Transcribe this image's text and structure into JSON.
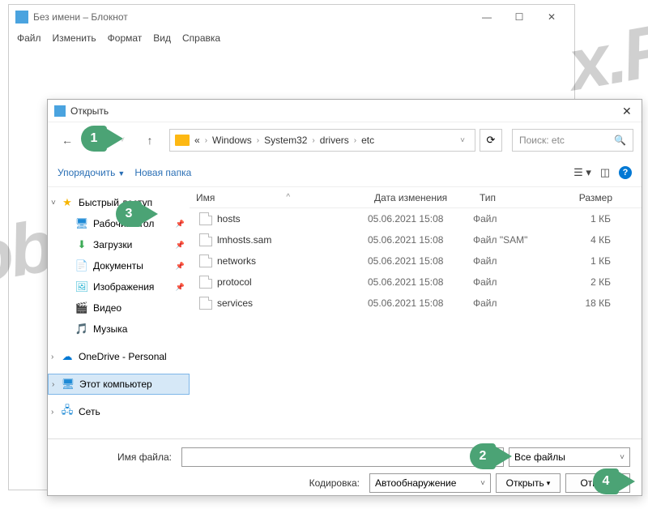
{
  "notepad": {
    "title": "Без имени – Блокнот",
    "menu": [
      "Файл",
      "Изменить",
      "Формат",
      "Вид",
      "Справка"
    ]
  },
  "dialog": {
    "title": "Открыть",
    "breadcrumb_prefix": "«",
    "crumbs": [
      "Windows",
      "System32",
      "drivers",
      "etc"
    ],
    "search_placeholder": "Поиск: etc",
    "organize_label": "Упорядочить",
    "newfolder_label": "Новая папка",
    "columns": {
      "name": "Имя",
      "date": "Дата изменения",
      "type": "Тип",
      "size": "Размер"
    },
    "sidebar": {
      "quick": "Быстрый доступ",
      "desktop": "Рабочий стол",
      "downloads": "Загрузки",
      "documents": "Документы",
      "images": "Изображения",
      "video": "Видео",
      "music": "Музыка",
      "onedrive": "OneDrive - Personal",
      "thispc": "Этот компьютер",
      "network": "Сеть"
    },
    "files": [
      {
        "name": "hosts",
        "date": "05.06.2021 15:08",
        "type": "Файл",
        "size": "1 КБ"
      },
      {
        "name": "lmhosts.sam",
        "date": "05.06.2021 15:08",
        "type": "Файл \"SAM\"",
        "size": "4 КБ"
      },
      {
        "name": "networks",
        "date": "05.06.2021 15:08",
        "type": "Файл",
        "size": "1 КБ"
      },
      {
        "name": "protocol",
        "date": "05.06.2021 15:08",
        "type": "Файл",
        "size": "2 КБ"
      },
      {
        "name": "services",
        "date": "05.06.2021 15:08",
        "type": "Файл",
        "size": "18 КБ"
      }
    ],
    "filename_label": "Имя файла:",
    "encoding_label": "Кодировка:",
    "encoding_value": "Автообнаружение",
    "filter_value": "Все файлы",
    "open_btn": "Открыть",
    "cancel_btn": "Отмена"
  },
  "callouts": {
    "c1": "1",
    "c2": "2",
    "c3": "3",
    "c4": "4"
  }
}
